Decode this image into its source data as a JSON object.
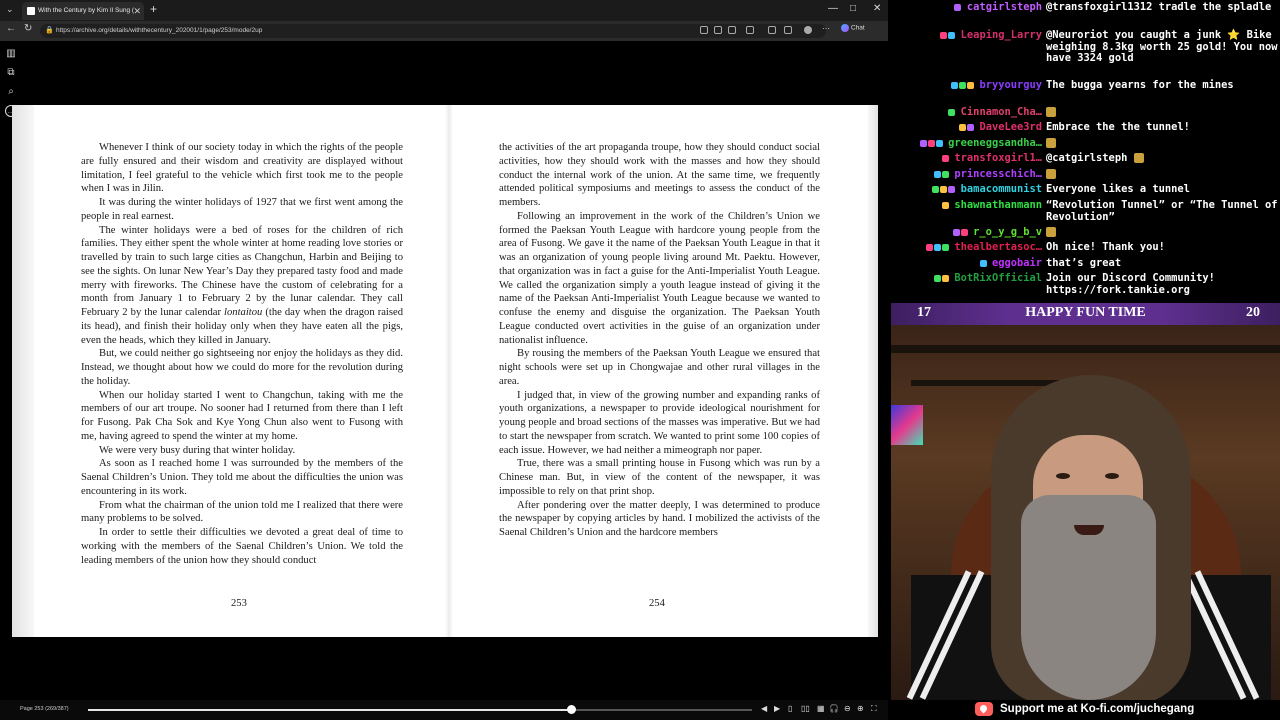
{
  "browser": {
    "tab_title": "With the Century by Kim Il Sung (",
    "url": "https://archive.org/details/withthecentury_202001/1/page/253/mode/2up",
    "chat_label": "Chat"
  },
  "book": {
    "left_page": {
      "paragraphs": [
        "Whenever I think of our society today in which the rights of the people are fully ensured and their wisdom and creativity are displayed without limitation, I feel grateful to the vehicle which first took me to the people when I was in Jilin.",
        "It was during the winter holidays of 1927 that we first went among the people in real earnest.",
        "The winter holidays were a bed of roses for the children of rich families. They either spent the whole winter at home reading love stories or travelled by train to such large cities as Changchun, Harbin and Beijing to see the sights. On lunar New Year’s Day they prepared tasty food and made merry with fireworks. The Chinese have the custom of celebrating for a month from January 1 to February 2 by the lunar calendar. They call February 2 by the lunar calendar lontaitou (the day when the dragon raised its head), and finish their holiday only when they have eaten all the pigs, even the heads, which they killed in January.",
        "But, we could neither go sightseeing nor enjoy the holidays as they did. Instead, we thought about how we could do more for the revolution during the holiday.",
        "When our holiday started I went to Changchun, taking with me the members of our art troupe. No sooner had I returned from there than I left for Fusong. Pak Cha Sok and Kye Yong Chun also went to Fusong with me, having agreed to spend the winter at my home.",
        "We were very busy during that winter holiday.",
        "As soon as I reached home I was surrounded by the members of the Saenal Children’s Union. They told me about the difficulties the union was encountering in its work.",
        "From what the chairman of the union told me I realized that there were many problems to be solved.",
        "In order to settle their difficulties we devoted a great deal of time to working with the members of the Saenal Children’s Union. We told the leading members of the union how they should conduct"
      ],
      "page_number": "253"
    },
    "right_page": {
      "paragraphs": [
        "the activities of the art propaganda troupe, how they should conduct social activities, how they should work with the masses and how they should conduct the internal work of the union. At the same time, we frequently attended political symposiums and meetings to assess the conduct of the members.",
        "Following an improvement in the work of the Children’s Union we formed the Paeksan Youth League with hardcore young people from the area of Fusong. We gave it the name of the Paeksan Youth League in that it was an organization of young people living around Mt. Paektu. However, that organization was in fact a guise for the Anti-Imperialist Youth League. We called the organization simply a youth league instead of giving it the name of the Paeksan Anti-Imperialist Youth League because we wanted to confuse the enemy and disguise the organization. The Paeksan Youth League conducted overt activities in the guise of an organization under nationalist influence.",
        "By rousing the members of the Paeksan Youth League we ensured that night schools were set up in Chongwajae and other rural villages in the area.",
        "I judged that, in view of the growing number and expanding ranks of youth organizations, a newspaper to provide ideological nourishment for young people and broad sections of the masses was imperative. But we had to start the newspaper from scratch. We wanted to print some 100 copies of each issue. However, we had neither a mimeograph nor paper.",
        "True, there was a small printing house in Fusong which was run by a Chinese man. But, in view of the content of the newspaper, it was impossible to rely on that print shop.",
        "After pondering over the matter deeply, I was determined to produce the newspaper by copying articles by hand. I mobilized the activists of the Saenal Children’s Union and the hardcore members"
      ],
      "page_number": "254"
    }
  },
  "viewer": {
    "page_indicator": "Page 253 (269/387)",
    "progress_fraction": 0.728
  },
  "chat": {
    "messages": [
      {
        "user": "catgirlsteph",
        "color": "#c25cff",
        "text": "@transfoxgirl1312 tradle the spladle"
      },
      {
        "user": "Leaping_Larry",
        "color": "#d6306b",
        "text": "@Neuroriot you caught a junk ⭐ Bike weighing 8.3kg worth 25 gold! You now have 3324 gold"
      },
      {
        "user": "bryyourguy",
        "color": "#8a3cff",
        "text": "The bugga yearns for the mines"
      },
      {
        "user": "Cinnamon_Cha…",
        "color": "#e0406a",
        "text": ""
      },
      {
        "user": "DaveLee3rd",
        "color": "#e0306a",
        "text": "Embrace the the tunnel!"
      },
      {
        "user": "greeneggsandha…",
        "color": "#3ad04a",
        "text": ""
      },
      {
        "user": "transfoxgirl1…",
        "color": "#e0306a",
        "text": "@catgirlsteph"
      },
      {
        "user": "princesschich…",
        "color": "#b040ff",
        "text": ""
      },
      {
        "user": "bamacommunist",
        "color": "#30d0e0",
        "text": "Everyone likes a tunnel"
      },
      {
        "user": "shawnathanmann",
        "color": "#30e040",
        "text": "“Revolution Tunnel” or “The Tunnel of Revolution”"
      },
      {
        "user": "r_o_y_g_b_v",
        "color": "#60e030",
        "text": ""
      },
      {
        "user": "thealbertasoc…",
        "color": "#e02050",
        "text": "Oh nice! Thank you!"
      },
      {
        "user": "eggobair",
        "color": "#c030ff",
        "text": "that’s great"
      },
      {
        "user": "BotRixOfficial",
        "color": "#20a040",
        "text": "Join our Discord Community! https://fork.tankie.org"
      }
    ]
  },
  "stream": {
    "title": "HAPPY FUN TIME",
    "left_number": "17",
    "right_number": "20",
    "support_text": "Support me at Ko-fi.com/juchegang"
  }
}
